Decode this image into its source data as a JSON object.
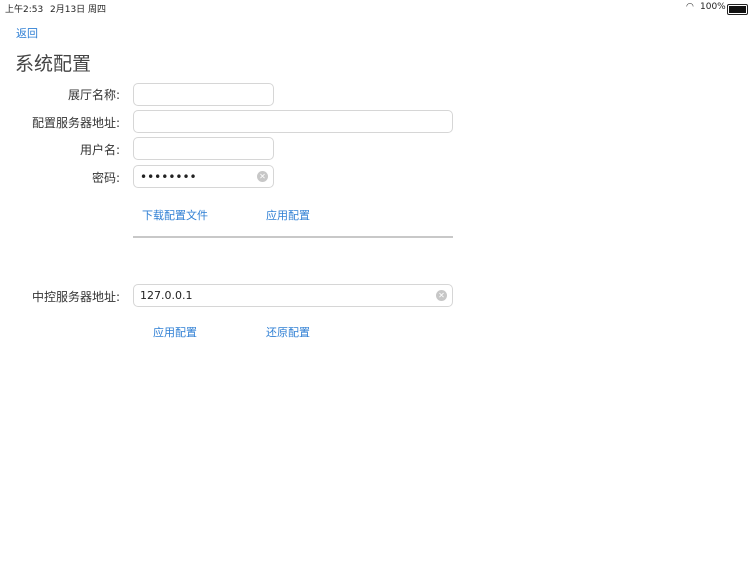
{
  "status_bar": {
    "time": "上午2:53",
    "date": "2月13日 周四",
    "battery": "100%"
  },
  "nav": {
    "back": "返回",
    "title": "系统配置"
  },
  "form": {
    "hall_name_label": "展厅名称:",
    "hall_name_value": "",
    "config_server_label": "配置服务器地址:",
    "config_server_value": "",
    "username_label": "用户名:",
    "username_value": "",
    "password_label": "密码:",
    "password_value": "••••••••",
    "download_button": "下载配置文件",
    "apply_button": "应用配置"
  },
  "central": {
    "server_label": "中控服务器地址:",
    "server_value": "127.0.0.1",
    "apply_button": "应用配置",
    "restore_button": "还原配置"
  }
}
